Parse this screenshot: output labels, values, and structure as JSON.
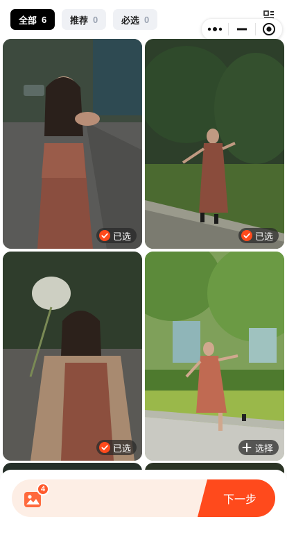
{
  "tabs": [
    {
      "label": "全部",
      "count": "6"
    },
    {
      "label": "推荐",
      "count": "0"
    },
    {
      "label": "必选",
      "count": "0"
    }
  ],
  "photos": [
    {
      "status": "已选",
      "state": "selected"
    },
    {
      "status": "已选",
      "state": "selected"
    },
    {
      "status": "已选",
      "state": "selected"
    },
    {
      "status": "选择",
      "state": "unselected"
    }
  ],
  "footer": {
    "selected_count": "4",
    "next_label": "下一步"
  },
  "colors": {
    "accent": "#ff4a1c",
    "pill_bg": "#fdeee5",
    "tab_active_bg": "#000000",
    "tab_inactive_bg": "#eff1f5"
  }
}
